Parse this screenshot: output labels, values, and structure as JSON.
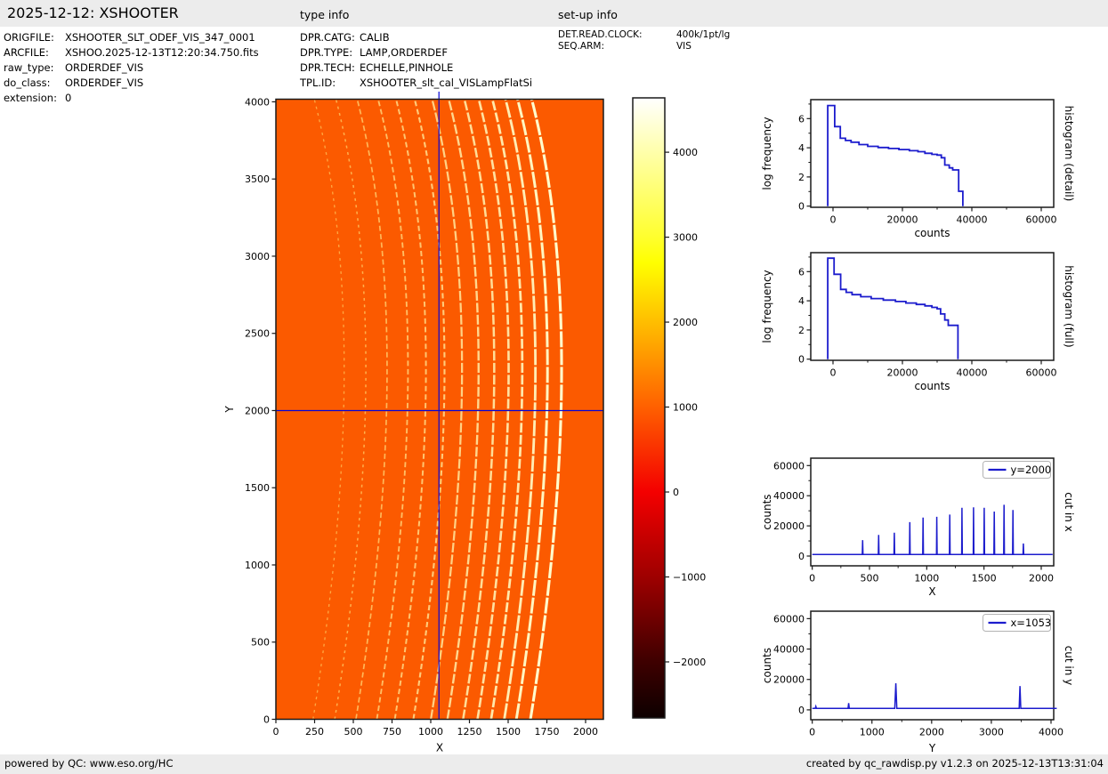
{
  "header": {
    "title": "2025-12-12: XSHOOTER",
    "type_info_label": "type info",
    "setup_info_label": "set-up info"
  },
  "file_info": {
    "rows": [
      {
        "label": "ORIGFILE:",
        "value": "XSHOOTER_SLT_ODEF_VIS_347_0001"
      },
      {
        "label": "ARCFILE:",
        "value": "XSHOO.2025-12-13T12:20:34.750.fits"
      },
      {
        "label": "raw_type:",
        "value": "ORDERDEF_VIS"
      },
      {
        "label": "do_class:",
        "value": "ORDERDEF_VIS"
      },
      {
        "label": "extension:",
        "value": "0"
      }
    ]
  },
  "type_info": {
    "rows": [
      {
        "label": "DPR.CATG:",
        "value": "CALIB"
      },
      {
        "label": "DPR.TYPE:",
        "value": "LAMP,ORDERDEF"
      },
      {
        "label": "DPR.TECH:",
        "value": "ECHELLE,PINHOLE"
      },
      {
        "label": "TPL.ID:",
        "value": "XSHOOTER_slt_cal_VISLampFlatSi"
      }
    ]
  },
  "setup_info": {
    "rows": [
      {
        "label": "DET.READ.CLOCK:",
        "value": "400k/1pt/lg"
      },
      {
        "label": "SEQ.ARM:",
        "value": "VIS"
      }
    ]
  },
  "footer": {
    "left": "powered by QC: www.eso.org/HC",
    "right": "created by qc_rawdisp.py v1.2.3 on 2025-12-13T13:31:04"
  },
  "colors": {
    "bar_bg": "#ececec",
    "image_background": "#fb5a00",
    "line_blue": "#1c1ccd",
    "cursor_blue": "#0505d8",
    "frame": "#1a1a1a",
    "order_faint": "#ffb036",
    "order_bright": "#fffdcd"
  },
  "chart_data": [
    {
      "id": "raw-image",
      "type": "heatmap",
      "description": "raw echelle order-definition frame, VIS arm",
      "xlabel": "X",
      "ylabel": "Y",
      "xlim": [
        0,
        2115
      ],
      "ylim": [
        0,
        4017
      ],
      "xticks": [
        0,
        250,
        500,
        750,
        1000,
        1250,
        1500,
        1750,
        2000
      ],
      "yticks": [
        0,
        500,
        1000,
        1500,
        2000,
        2500,
        3000,
        3500,
        4000
      ],
      "background_counts": 1100,
      "cursor": {
        "x": 1053,
        "y": 2000
      },
      "order_curve": {
        "bow": 200,
        "apex_y": 2250
      },
      "orders": [
        {
          "x_center": 440,
          "peak_counts": 10500,
          "intensity": 0.2
        },
        {
          "x_center": 580,
          "peak_counts": 14000,
          "intensity": 0.28
        },
        {
          "x_center": 717,
          "peak_counts": 15500,
          "intensity": 0.36
        },
        {
          "x_center": 852,
          "peak_counts": 22500,
          "intensity": 0.44
        },
        {
          "x_center": 968,
          "peak_counts": 25500,
          "intensity": 0.5
        },
        {
          "x_center": 1088,
          "peak_counts": 26000,
          "intensity": 0.56
        },
        {
          "x_center": 1201,
          "peak_counts": 27500,
          "intensity": 0.62
        },
        {
          "x_center": 1308,
          "peak_counts": 32000,
          "intensity": 0.68
        },
        {
          "x_center": 1409,
          "peak_counts": 32300,
          "intensity": 0.73
        },
        {
          "x_center": 1502,
          "peak_counts": 32000,
          "intensity": 0.78
        },
        {
          "x_center": 1590,
          "peak_counts": 29500,
          "intensity": 0.83
        },
        {
          "x_center": 1675,
          "peak_counts": 34000,
          "intensity": 0.88
        },
        {
          "x_center": 1753,
          "peak_counts": 30500,
          "intensity": 0.95
        },
        {
          "x_center": 1844,
          "peak_counts": 8300,
          "intensity": 1.0
        }
      ]
    },
    {
      "id": "colorbar",
      "type": "colorbar",
      "vmin": -2660,
      "vmax": 4640,
      "ticks": [
        {
          "value": 4000,
          "label": "4000"
        },
        {
          "value": 3000,
          "label": "3000"
        },
        {
          "value": 2000,
          "label": "2000"
        },
        {
          "value": 1000,
          "label": "1000"
        },
        {
          "value": 0,
          "label": "0"
        },
        {
          "value": -1000,
          "label": "−1000"
        },
        {
          "value": -2000,
          "label": "−2000"
        }
      ],
      "stops": [
        {
          "value": 4640,
          "color": "#ffffff"
        },
        {
          "value": 4000,
          "color": "#ffffaa"
        },
        {
          "value": 3000,
          "color": "#ffff2e"
        },
        {
          "value": 2700,
          "color": "#ffff00"
        },
        {
          "value": 2000,
          "color": "#ffbe00"
        },
        {
          "value": 1000,
          "color": "#ff6000"
        },
        {
          "value": 0,
          "color": "#f40000"
        },
        {
          "value": -1000,
          "color": "#9e0000"
        },
        {
          "value": -2000,
          "color": "#3e0000"
        },
        {
          "value": -2660,
          "color": "#0d0000"
        }
      ]
    },
    {
      "id": "histogram-detail",
      "type": "line",
      "right_label": "histogram (detail)",
      "xlabel": "counts",
      "ylabel": "log frequency",
      "xlim": [
        -6410,
        63590
      ],
      "ylim": [
        -0.08,
        7.3
      ],
      "xticks": [
        0,
        20000,
        40000,
        60000
      ],
      "xminor": [
        10000,
        30000,
        50000
      ],
      "yticks": [
        0,
        2,
        4,
        6
      ],
      "yminor": [
        1,
        3,
        5,
        7
      ],
      "points": [
        [
          -1500,
          0
        ],
        [
          -1500,
          6.9
        ],
        [
          500,
          6.9
        ],
        [
          500,
          5.45
        ],
        [
          2100,
          5.45
        ],
        [
          2100,
          4.65
        ],
        [
          3600,
          4.65
        ],
        [
          3600,
          4.5
        ],
        [
          5200,
          4.5
        ],
        [
          5200,
          4.38
        ],
        [
          7500,
          4.38
        ],
        [
          7500,
          4.22
        ],
        [
          10000,
          4.22
        ],
        [
          10000,
          4.1
        ],
        [
          13000,
          4.1
        ],
        [
          13000,
          4.02
        ],
        [
          16000,
          4.02
        ],
        [
          16000,
          3.95
        ],
        [
          19000,
          3.95
        ],
        [
          19000,
          3.88
        ],
        [
          22000,
          3.88
        ],
        [
          22000,
          3.8
        ],
        [
          24500,
          3.8
        ],
        [
          24500,
          3.73
        ],
        [
          26500,
          3.73
        ],
        [
          26500,
          3.62
        ],
        [
          28500,
          3.62
        ],
        [
          28500,
          3.55
        ],
        [
          30000,
          3.55
        ],
        [
          30000,
          3.5
        ],
        [
          31200,
          3.5
        ],
        [
          31200,
          3.32
        ],
        [
          32200,
          3.32
        ],
        [
          32200,
          2.82
        ],
        [
          33500,
          2.82
        ],
        [
          33500,
          2.62
        ],
        [
          34500,
          2.62
        ],
        [
          34500,
          2.48
        ],
        [
          36200,
          2.48
        ],
        [
          36200,
          1.02
        ],
        [
          37400,
          1.02
        ],
        [
          37400,
          0
        ]
      ]
    },
    {
      "id": "histogram-full",
      "type": "line",
      "right_label": "histogram (full)",
      "xlabel": "counts",
      "ylabel": "log frequency",
      "xlim": [
        -6410,
        63590
      ],
      "ylim": [
        -0.08,
        7.3
      ],
      "xticks": [
        0,
        20000,
        40000,
        60000
      ],
      "xminor": [
        10000,
        30000,
        50000
      ],
      "yticks": [
        0,
        2,
        4,
        6
      ],
      "yminor": [
        1,
        3,
        5,
        7
      ],
      "points": [
        [
          -1500,
          0
        ],
        [
          -1500,
          6.92
        ],
        [
          300,
          6.92
        ],
        [
          300,
          5.82
        ],
        [
          2200,
          5.82
        ],
        [
          2200,
          4.78
        ],
        [
          3800,
          4.78
        ],
        [
          3800,
          4.58
        ],
        [
          5500,
          4.58
        ],
        [
          5500,
          4.42
        ],
        [
          8000,
          4.42
        ],
        [
          8000,
          4.28
        ],
        [
          11000,
          4.28
        ],
        [
          11000,
          4.15
        ],
        [
          14500,
          4.15
        ],
        [
          14500,
          4.05
        ],
        [
          18000,
          4.05
        ],
        [
          18000,
          3.95
        ],
        [
          21000,
          3.95
        ],
        [
          21000,
          3.85
        ],
        [
          24000,
          3.85
        ],
        [
          24000,
          3.75
        ],
        [
          26500,
          3.75
        ],
        [
          26500,
          3.65
        ],
        [
          28500,
          3.65
        ],
        [
          28500,
          3.55
        ],
        [
          30000,
          3.55
        ],
        [
          30000,
          3.45
        ],
        [
          31000,
          3.45
        ],
        [
          31000,
          3.1
        ],
        [
          32200,
          3.1
        ],
        [
          32200,
          2.68
        ],
        [
          33200,
          2.68
        ],
        [
          33200,
          2.32
        ],
        [
          36000,
          2.32
        ],
        [
          36000,
          0
        ]
      ]
    },
    {
      "id": "cut-in-x",
      "type": "cut",
      "legend": "y=2000",
      "right_label": "cut in x",
      "xlabel": "X",
      "ylabel": "counts",
      "xlim": [
        -13,
        2109
      ],
      "ylim": [
        -6490,
        64900
      ],
      "xticks": [
        0,
        500,
        1000,
        1500,
        2000
      ],
      "xminor": [
        250,
        750,
        1250,
        1750
      ],
      "yticks": [
        0,
        20000,
        40000,
        60000
      ],
      "yminor": [
        10000,
        30000,
        50000
      ],
      "baseline": 1000,
      "x_range": [
        0,
        2100
      ],
      "peaks": [
        [
          440,
          10500,
          6
        ],
        [
          580,
          14000,
          6
        ],
        [
          717,
          15500,
          6
        ],
        [
          852,
          22500,
          6
        ],
        [
          968,
          25500,
          6
        ],
        [
          1088,
          26000,
          6
        ],
        [
          1201,
          27500,
          6
        ],
        [
          1308,
          32000,
          6
        ],
        [
          1409,
          32300,
          6
        ],
        [
          1502,
          32000,
          6
        ],
        [
          1590,
          29500,
          6
        ],
        [
          1675,
          34000,
          6
        ],
        [
          1753,
          30500,
          6
        ],
        [
          1844,
          8300,
          6
        ]
      ]
    },
    {
      "id": "cut-in-y",
      "type": "cut",
      "legend": "x=1053",
      "right_label": "cut in y",
      "xlabel": "Y",
      "ylabel": "counts",
      "xlim": [
        -25,
        4045
      ],
      "ylim": [
        -6490,
        64900
      ],
      "xticks": [
        0,
        1000,
        2000,
        3000,
        4000
      ],
      "xminor": [
        500,
        1500,
        2500,
        3500
      ],
      "yticks": [
        0,
        20000,
        40000,
        60000
      ],
      "yminor": [
        10000,
        30000,
        50000
      ],
      "baseline": 1000,
      "x_range": [
        0,
        4096
      ],
      "peaks": [
        [
          60,
          2300,
          22
        ],
        [
          610,
          4400,
          22
        ],
        [
          1400,
          17500,
          34
        ],
        [
          3480,
          15700,
          26
        ]
      ]
    }
  ]
}
